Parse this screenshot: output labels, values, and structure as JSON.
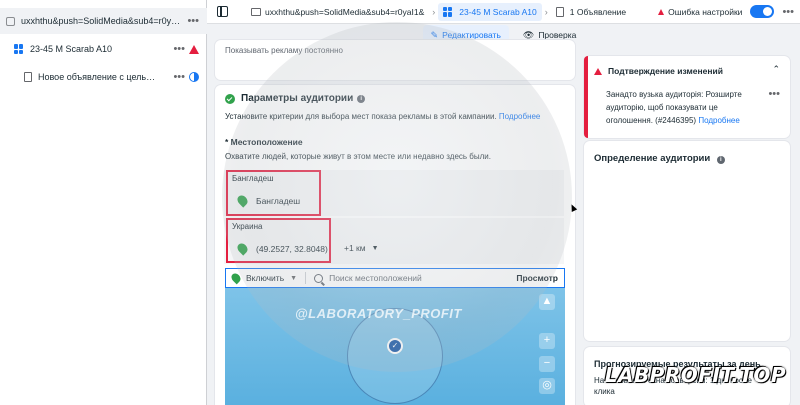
{
  "tree": {
    "campaign": {
      "label": "uxxhthu&push=SolidMedia&sub4=r0yaI…",
      "more": "•••"
    },
    "adset": {
      "label": "23-45 M Scarab A10",
      "more": "•••"
    },
    "ad": {
      "label": "Новое объявление с цель…",
      "more": "•••"
    }
  },
  "topbar": {
    "crumb_campaign": "uxxhthu&push=SolidMedia&sub4=r0yaI1&",
    "crumb_adset": "23-45 M Scarab A10",
    "crumb_ad": "1 Объявление",
    "error": "Ошибка настройки",
    "more": "•••"
  },
  "subbar": {
    "edit": "Редактировать",
    "review": "Проверка"
  },
  "top_card": {
    "text": "Показывать рекламу постоянно"
  },
  "audience": {
    "title": "Параметры аудитории",
    "desc": "Установите критерии для выбора мест показа рекламы в этой кампании.",
    "desc_link": "Подробнее",
    "location_label": "* Местоположение",
    "location_desc": "Охватите людей, которые живут в этом месте или недавно здесь были.",
    "regions": [
      {
        "name": "Бангладеш",
        "location": "Бангладеш"
      },
      {
        "name": "Украина",
        "location": "(49.2527, 32.8048)",
        "radius": "+1 км"
      }
    ],
    "search": {
      "include": "Включить",
      "placeholder": "Поиск местоположений",
      "preview": "Просмотр"
    }
  },
  "warning": {
    "title": "Подтверждение изменений",
    "body": "Занадто вузька аудиторія: Розширте аудиторію, щоб показувати це оголошення. (#2446395)",
    "link": "Подробнее",
    "more": "•••"
  },
  "definition": {
    "title": "Определение аудитории"
  },
  "forecast": {
    "title": "Прогнозируемые результаты за день",
    "sub": "На основании окна конверсий: 1 дн. после клика"
  },
  "watermark": "@LABORATORY_PROFIT",
  "brand": "LABPROFIT.TOP",
  "colors": {
    "accent": "#1877f2",
    "error": "#e41e3f",
    "success": "#31a24c"
  }
}
